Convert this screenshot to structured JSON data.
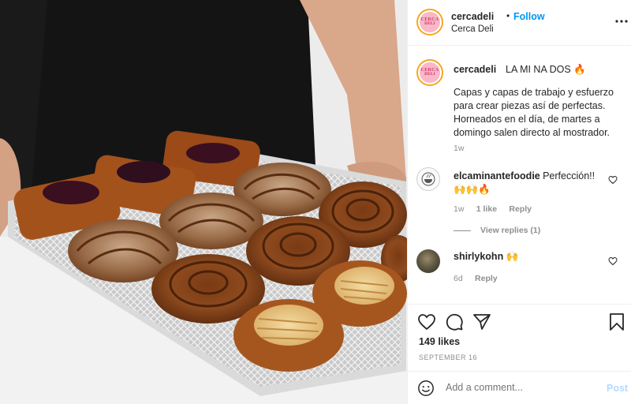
{
  "colors": {
    "accent": "#0095f6",
    "muted": "#8e8e8e",
    "text": "#262626",
    "post_disabled": "#b3dbff"
  },
  "post": {
    "image_alt": "Tray of pastries",
    "header": {
      "username": "cercadeli",
      "separator": "•",
      "follow_label": "Follow",
      "location": "Cerca Deli",
      "more_icon": "more-horizontal-icon"
    },
    "avatar": {
      "line1": "CERCA",
      "line2": "DELI"
    },
    "caption": {
      "username": "cercadeli",
      "title": "LA MI NA DOS 🔥",
      "body": "Capas y capas de trabajo y esfuerzo para crear piezas así de perfectas. Horneados en el día, de martes a domingo salen directo al mostrador.",
      "time": "1w"
    },
    "comments": [
      {
        "username": "elcaminantefoodie",
        "text": "Perfección!!",
        "emoji": "🙌🙌🔥",
        "time": "1w",
        "likes": "1 like",
        "reply": "Reply",
        "view_replies": "View replies (1)"
      },
      {
        "username": "shirlykohn",
        "text": "🙌",
        "time": "6d",
        "reply": "Reply"
      }
    ],
    "likes": "149 likes",
    "date": "SEPTEMBER 16",
    "add_comment": {
      "placeholder": "Add a comment...",
      "post_label": "Post"
    }
  }
}
